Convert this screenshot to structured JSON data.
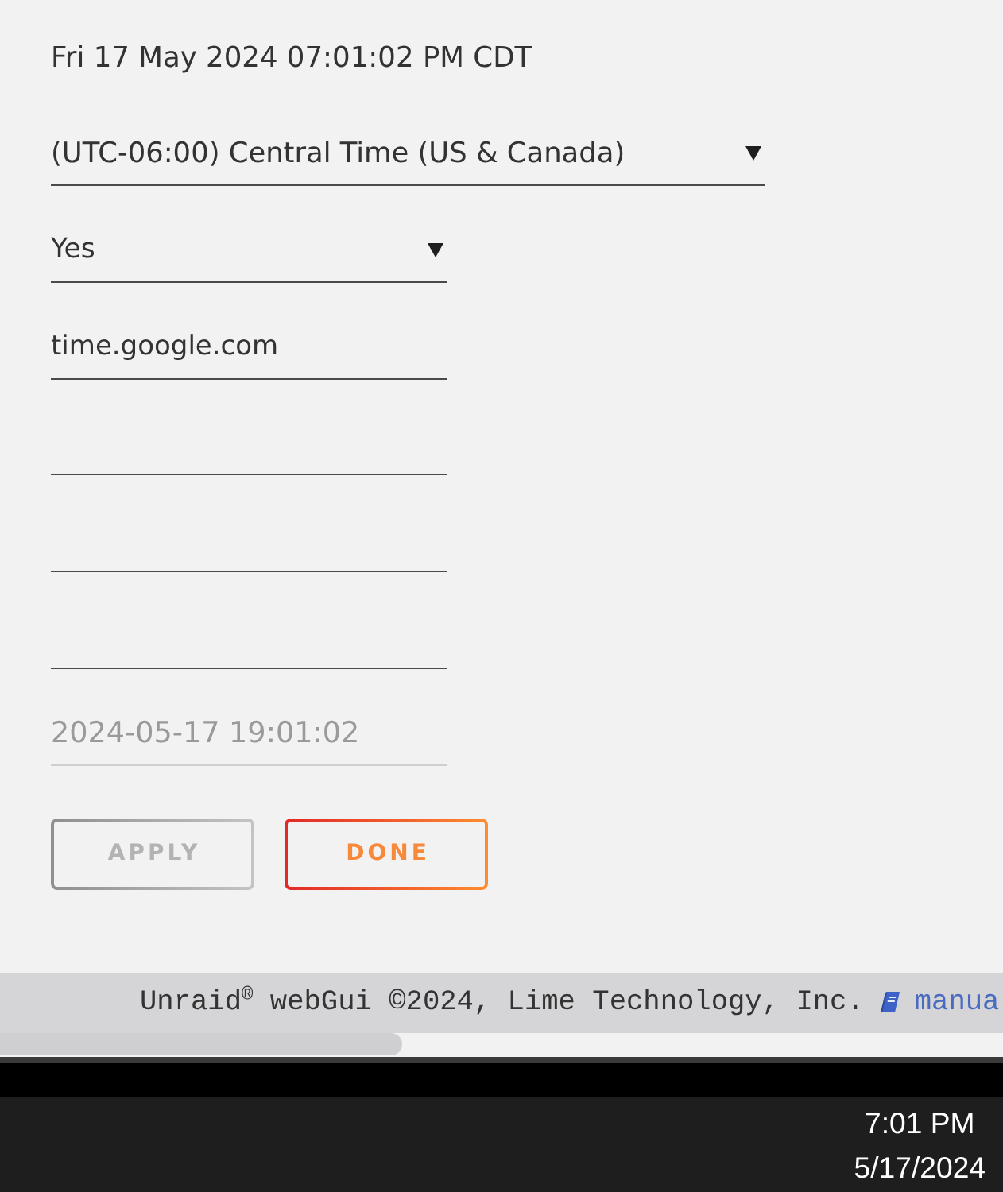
{
  "current_time": "Fri 17 May 2024 07:01:02 PM CDT",
  "fields": [
    {
      "kind": "select",
      "value": "(UTC-06:00) Central Time (US & Canada)",
      "disabled": false
    },
    {
      "kind": "select",
      "value": "Yes",
      "disabled": false
    },
    {
      "kind": "input",
      "value": "time.google.com",
      "disabled": false
    },
    {
      "kind": "input",
      "disabled": false
    },
    {
      "kind": "input",
      "disabled": false
    },
    {
      "kind": "input",
      "disabled": false
    },
    {
      "kind": "input",
      "value": "2024-05-17 19:01:02",
      "disabled": true
    }
  ],
  "buttons": [
    {
      "label": "APPLY",
      "disabled": true
    },
    {
      "label": "DONE",
      "disabled": false
    }
  ],
  "footer": {
    "text": "Unraid$^{®}$ webGui ©2024, Lime Technology, Inc.",
    "link": "manua"
  },
  "taskbar": {
    "time": "7:01 PM",
    "date": "5/17/2024"
  }
}
